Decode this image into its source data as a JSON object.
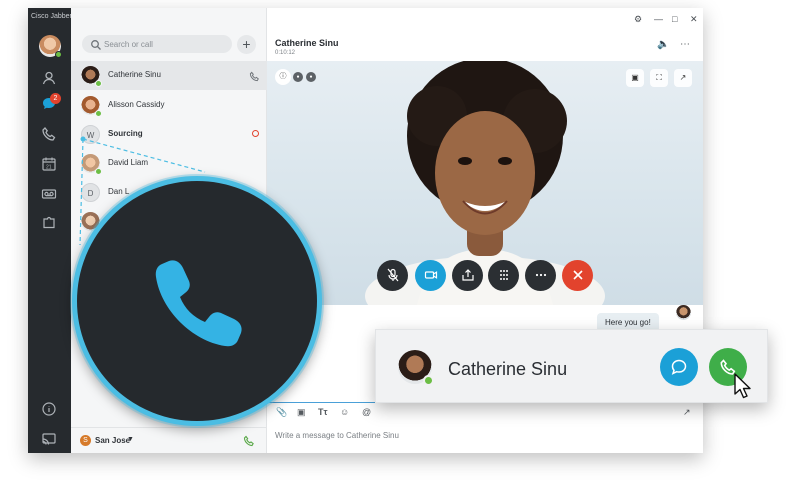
{
  "app": {
    "title": "Cisco Jabber"
  },
  "rail": {
    "messages_badge": "2"
  },
  "search": {
    "placeholder": "Search or call"
  },
  "contacts": [
    {
      "name": "Catherine Sinu",
      "selected": true
    },
    {
      "name": "Alisson Cassidy"
    },
    {
      "name": "Sourcing",
      "initial": "W",
      "bold": true
    },
    {
      "name": "David Liam"
    },
    {
      "name": "Dan L",
      "initial": "D"
    },
    {
      "name": ""
    }
  ],
  "footer": {
    "location_badge": "S",
    "location": "San Jose"
  },
  "conversation": {
    "title": "Catherine Sinu",
    "timer": "0:10:12",
    "message": "Here you go!",
    "compose_placeholder": "Write a message to Catherine Sinu"
  },
  "toast": {
    "name": "Catherine Sinu"
  },
  "colors": {
    "rail": "#262a2e",
    "accent_blue": "#1ba0d7",
    "call_green": "#3fae49",
    "end_red": "#e2432d",
    "callout_ring": "#4bbde3"
  }
}
